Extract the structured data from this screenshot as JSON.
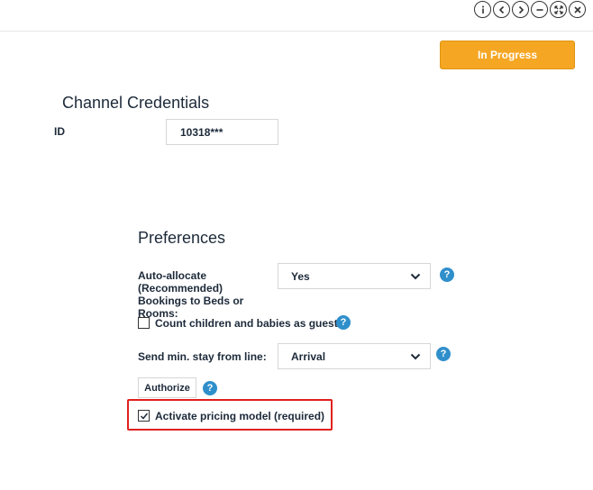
{
  "window": {
    "controls": [
      {
        "name": "info-icon"
      },
      {
        "name": "back-icon"
      },
      {
        "name": "forward-icon"
      },
      {
        "name": "minimize-icon"
      },
      {
        "name": "expand-icon"
      },
      {
        "name": "close-icon"
      }
    ]
  },
  "status_button": {
    "label": "In Progress",
    "color": "#f5a623"
  },
  "credentials": {
    "title": "Channel Credentials",
    "id_label": "ID",
    "id_value": "10318***"
  },
  "preferences": {
    "title": "Preferences",
    "auto_allocate": {
      "label": "Auto-allocate (Recommended) Bookings to Beds or Rooms:",
      "value": "Yes"
    },
    "count_children": {
      "label": "Count children and babies as guests",
      "checked": false
    },
    "min_stay": {
      "label": "Send min. stay from line:",
      "value": "Arrival"
    },
    "authorize_label": "Authorize",
    "activate_pricing": {
      "label": "Activate pricing model (required)",
      "checked": true
    },
    "help_glyph": "?",
    "help_color": "#2f8fcb"
  },
  "highlight_color": "#e0201e"
}
